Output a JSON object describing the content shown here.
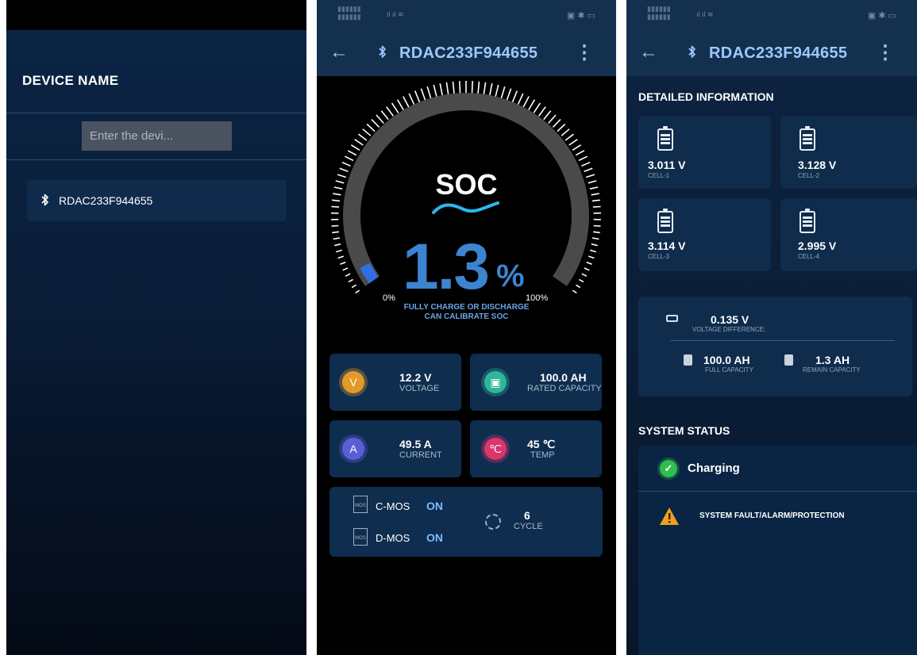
{
  "screen1": {
    "title": "DEVICE NAME",
    "search_placeholder": "Enter the devi...",
    "device_name": "RDAC233F944655",
    "icons": {
      "device": "bluetooth-icon"
    }
  },
  "screen2": {
    "device_name": "RDAC233F944655",
    "soc_title": "SOC",
    "soc_value": "1.3",
    "soc_unit": "%",
    "soc_fraction": 0.013,
    "gauge_min": "0%",
    "gauge_max": "100%",
    "calibrate_line1": "FULLY CHARGE OR DISCHARGE",
    "calibrate_line2": "CAN CALIBRATE SOC",
    "voltage": {
      "value": "12.2 V",
      "label": "VOLTAGE"
    },
    "rated_capacity": {
      "value": "100.0 AH",
      "label": "RATED CAPACITY"
    },
    "current": {
      "value": "49.5 A",
      "label": "CURRENT"
    },
    "temp": {
      "value": "45 ℃",
      "label": "TEMP"
    },
    "cmos": {
      "label": "C-MOS",
      "state": "ON"
    },
    "dmos": {
      "label": "D-MOS",
      "state": "ON"
    },
    "mos_icon_text": "MOS",
    "cycle": {
      "value": "6",
      "label": "CYCLE"
    },
    "colors": {
      "accent": "#3c84cf",
      "voltage_icon": "#e39a2a",
      "capacity_icon": "#2fb59a",
      "current_icon": "#5a5fd6",
      "temp_icon": "#d9356f"
    }
  },
  "screen3": {
    "device_name": "RDAC233F944655",
    "detail_title": "DETAILED INFORMATION",
    "cells": [
      {
        "value": "3.011 V",
        "label": "CELL-1"
      },
      {
        "value": "3.128 V",
        "label": "CELL-2"
      },
      {
        "value": "3.114 V",
        "label": "CELL-3"
      },
      {
        "value": "2.995 V",
        "label": "CELL-4"
      }
    ],
    "voltage_difference": {
      "value": "0.135 V",
      "label": "VOLTAGE DIFFERENCE:"
    },
    "full_capacity": {
      "value": "100.0 AH",
      "label": "FULL CAPACITY"
    },
    "remain_capacity": {
      "value": "1.3 AH",
      "label": "REMAIN CAPACITY"
    },
    "system_title": "SYSTEM STATUS",
    "charging": "Charging",
    "fault": "SYSTEM FAULT/ALARM/PROTECTION",
    "colors": {
      "ok": "#2fbf4f",
      "warn": "#f0a020"
    }
  }
}
